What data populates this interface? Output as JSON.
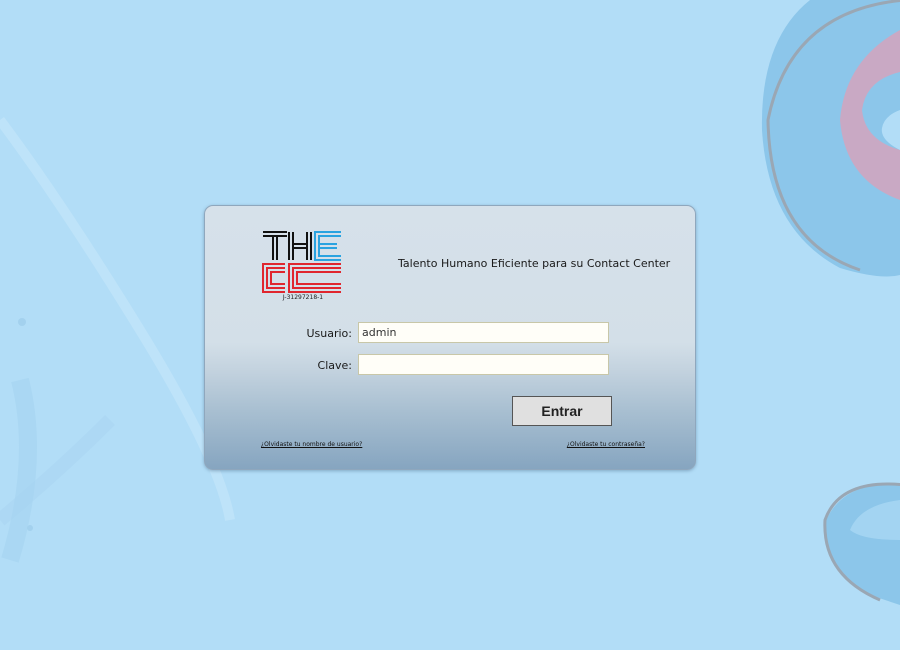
{
  "logo": {
    "text": "THECC",
    "rif": "J-31297218-1",
    "colors": {
      "black": "#111111",
      "blue": "#2aa3e0",
      "red": "#e0262e"
    }
  },
  "tagline": "Talento Humano Eficiente para su Contact Center",
  "form": {
    "user_label": "Usuario:",
    "user_value": "admin",
    "password_label": "Clave:",
    "password_value": "",
    "submit_label": "Entrar"
  },
  "links": {
    "forgot_user": "¿Olvidaste tu nombre de usuario?",
    "forgot_password": "¿Olvidaste tu contraseña?"
  },
  "colors": {
    "background": "#b2ddf7",
    "panel_top": "#d6e1ea",
    "panel_bottom": "#86a5c0"
  }
}
